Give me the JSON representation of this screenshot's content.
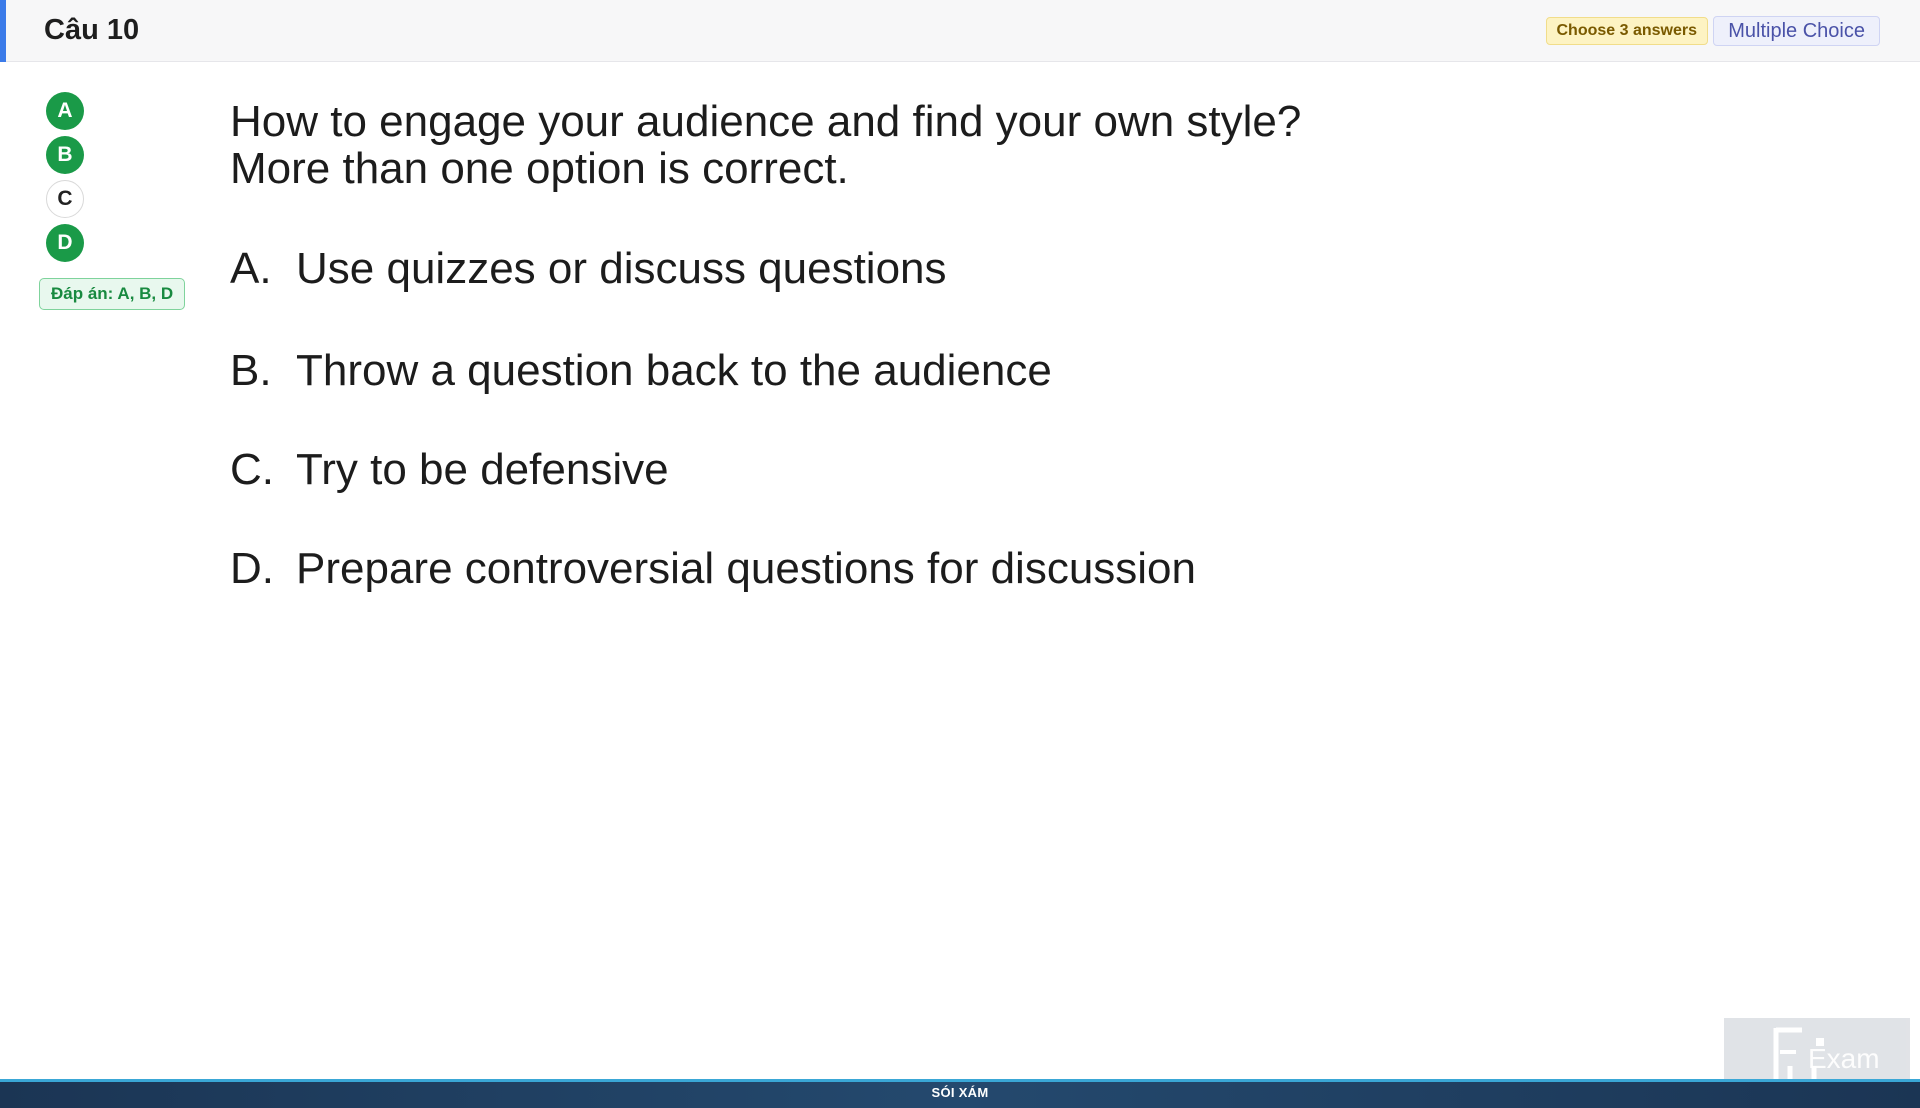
{
  "header": {
    "title": "Câu 10",
    "choose_badge": "Choose 3 answers",
    "type_badge": "Multiple Choice"
  },
  "answers_sidebar": {
    "options": [
      {
        "label": "A",
        "selected": true
      },
      {
        "label": "B",
        "selected": true
      },
      {
        "label": "C",
        "selected": false
      },
      {
        "label": "D",
        "selected": true
      }
    ],
    "answer_text": "Đáp án: A, B, D",
    "selected_color": "#1a9a48"
  },
  "question": {
    "line1": "How to engage your audience and find your own style?",
    "line2": "More than one option is correct.",
    "choices": [
      {
        "letter": "A.",
        "text": "Use quizzes or discuss questions"
      },
      {
        "letter": "B.",
        "text": "Throw a question back to the audience"
      },
      {
        "letter": "C.",
        "text": "Try to be defensive"
      },
      {
        "letter": "D.",
        "text": "Prepare controversial questions for discussion"
      }
    ]
  },
  "footer": {
    "label": "SÓI XÁM"
  },
  "logo": {
    "icon": "fu-exam-logo",
    "text": "FU Exam"
  }
}
